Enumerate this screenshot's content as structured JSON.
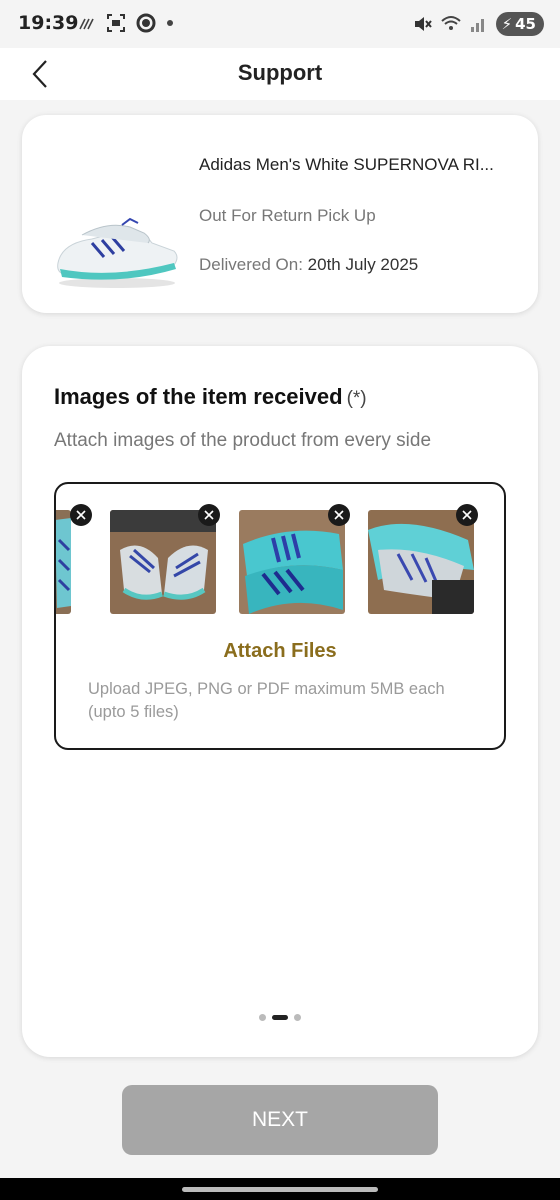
{
  "status_bar": {
    "time": "19:39",
    "battery_level": "45",
    "left_icons": [
      "data-saver-icon",
      "screenshot-icon",
      "circle-icon",
      "dot-icon"
    ],
    "right_icons": [
      "mute-icon",
      "wifi-icon",
      "signal-icon",
      "battery-icon"
    ]
  },
  "header": {
    "title": "Support",
    "back_icon": "chevron-left-icon"
  },
  "product": {
    "name": "Adidas Men's White SUPERNOVA RI...",
    "status": "Out For Return Pick Up",
    "delivered_label": "Delivered On: ",
    "delivered_date": "20th July 2025"
  },
  "upload": {
    "title": "Images of the item received",
    "required_mark": "(*)",
    "subtitle": "Attach images of the product from every side",
    "attach_label": "Attach Files",
    "hint": "Upload JPEG, PNG or PDF maximum 5MB each (upto 5 files)",
    "thumbnails": [
      "shoe-photo-1",
      "shoe-photo-2",
      "shoe-photo-3",
      "shoe-photo-4"
    ]
  },
  "pager": {
    "pages": 3,
    "active_index": 1
  },
  "footer": {
    "next_label": "NEXT"
  },
  "colors": {
    "accent": "#8a6d1d",
    "button_disabled": "#a6a6a6",
    "background": "#f4f4f4"
  }
}
